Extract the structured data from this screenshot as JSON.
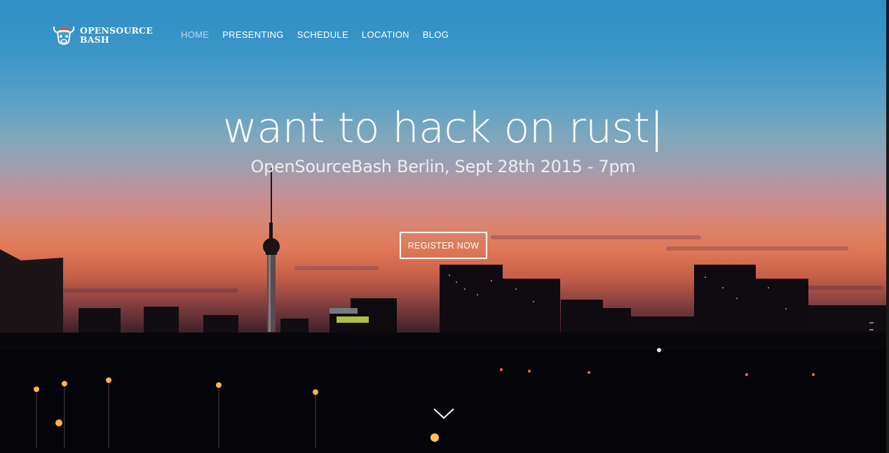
{
  "brand": {
    "line1": "OPENSOURCE",
    "line2": "BASH",
    "logo_icon": "bull-logo-icon"
  },
  "nav": {
    "items": [
      {
        "label": "HOME",
        "active": true
      },
      {
        "label": "PRESENTING",
        "active": false
      },
      {
        "label": "SCHEDULE",
        "active": false
      },
      {
        "label": "LOCATION",
        "active": false
      },
      {
        "label": "BLOG",
        "active": false
      }
    ]
  },
  "hero": {
    "headline": "want to hack on rust",
    "cursor": "|",
    "subtitle": "OpenSourceBash Berlin, Sept 28th 2015 - 7pm",
    "cta_label": "REGISTER NOW",
    "scroll_icon": "chevron-down-icon"
  },
  "colors": {
    "sky_top": "#2f8fc5",
    "sunset": "#e07957",
    "text": "#ffffff",
    "light_glow": "#ffb347"
  }
}
